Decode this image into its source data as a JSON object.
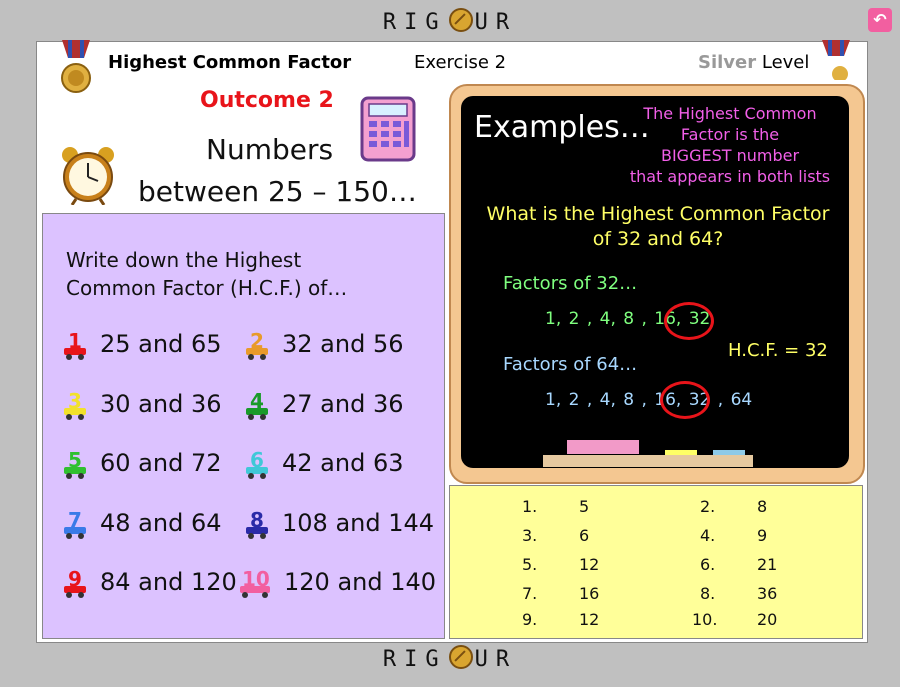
{
  "brand": {
    "left": "RIG",
    "right": "UR"
  },
  "header": {
    "topic": "Highest Common Factor",
    "exercise": "Exercise 2",
    "level_word": "Silver",
    "level_suffix": "Level"
  },
  "outcome": "Outcome 2",
  "subtitle": {
    "line1": "Numbers",
    "line2": "between 25 – 150…"
  },
  "questions": {
    "intro_line1": "Write down the Highest",
    "intro_line2": "Common Factor (H.C.F.) of…",
    "items": [
      {
        "num": "1",
        "text": "25 and 65",
        "color": "#e8141a"
      },
      {
        "num": "2",
        "text": "32 and 56",
        "color": "#e89a2a"
      },
      {
        "num": "3",
        "text": "30 and 36",
        "color": "#f2e12a"
      },
      {
        "num": "4",
        "text": "27 and 36",
        "color": "#1a9a2a"
      },
      {
        "num": "5",
        "text": "60 and 72",
        "color": "#30c030"
      },
      {
        "num": "6",
        "text": "42 and 63",
        "color": "#40c8d8"
      },
      {
        "num": "7",
        "text": "48 and 64",
        "color": "#3a7ae8"
      },
      {
        "num": "8",
        "text": "108 and 144",
        "color": "#2a2aa8"
      },
      {
        "num": "9",
        "text": "84 and 120",
        "color": "#e8141a"
      },
      {
        "num": "10",
        "text": "120 and 140",
        "color": "#f25fa0"
      }
    ]
  },
  "example": {
    "title": "Examples…",
    "note": [
      "The Highest Common",
      "Factor is the",
      "BIGGEST number",
      "that appears in both lists"
    ],
    "question": [
      "What is the Highest Common Factor",
      "of 32 and 64?"
    ],
    "factors32_label": "Factors of 32…",
    "factors32": "1, 2 , 4, 8 , 16, 32",
    "factors64_label": "Factors of 64…",
    "factors64": "1, 2 , 4, 8 , 16, 32 , 64",
    "answer": "H.C.F. = 32"
  },
  "answers": [
    {
      "n": "1.",
      "v": "5"
    },
    {
      "n": "2.",
      "v": "8"
    },
    {
      "n": "3.",
      "v": "6"
    },
    {
      "n": "4.",
      "v": "9"
    },
    {
      "n": "5.",
      "v": "12"
    },
    {
      "n": "6.",
      "v": "21"
    },
    {
      "n": "7.",
      "v": "16"
    },
    {
      "n": "8.",
      "v": "36"
    },
    {
      "n": "9.",
      "v": "12"
    },
    {
      "n": "10.",
      "v": "20"
    }
  ]
}
